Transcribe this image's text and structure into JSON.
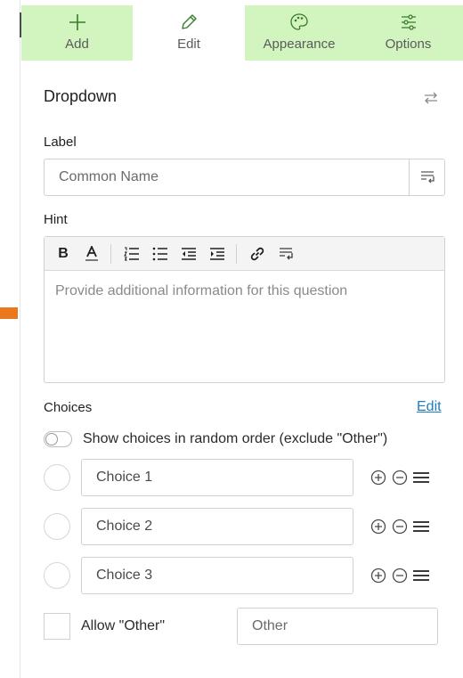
{
  "tabs": [
    {
      "label": "Add",
      "icon": "plus-icon",
      "active": true
    },
    {
      "label": "Edit",
      "icon": "pencil-icon",
      "active": false
    },
    {
      "label": "Appearance",
      "icon": "palette-icon",
      "active": true
    },
    {
      "label": "Options",
      "icon": "sliders-icon",
      "active": true
    }
  ],
  "section": {
    "title": "Dropdown",
    "swap_icon": "swap-arrows-icon"
  },
  "label_field": {
    "label": "Label",
    "placeholder": "Common Name",
    "value": "",
    "button_icon": "insert-field-icon"
  },
  "hint_field": {
    "label": "Hint",
    "toolbar": {
      "bold": "B"
    },
    "placeholder": "Provide additional information for this question"
  },
  "choices": {
    "label": "Choices",
    "edit_link": "Edit",
    "random_order_label": "Show choices in random order (exclude \"Other\")",
    "random_order_on": false,
    "items": [
      {
        "value": "Choice 1"
      },
      {
        "value": "Choice 2"
      },
      {
        "value": "Choice 3"
      }
    ],
    "allow_other_label": "Allow \"Other\"",
    "allow_other_checked": false,
    "other_placeholder": "Other"
  },
  "colors": {
    "active_tab": "#d2f4bf",
    "link": "#1f7dbf",
    "accent_orange": "#e9781f"
  }
}
